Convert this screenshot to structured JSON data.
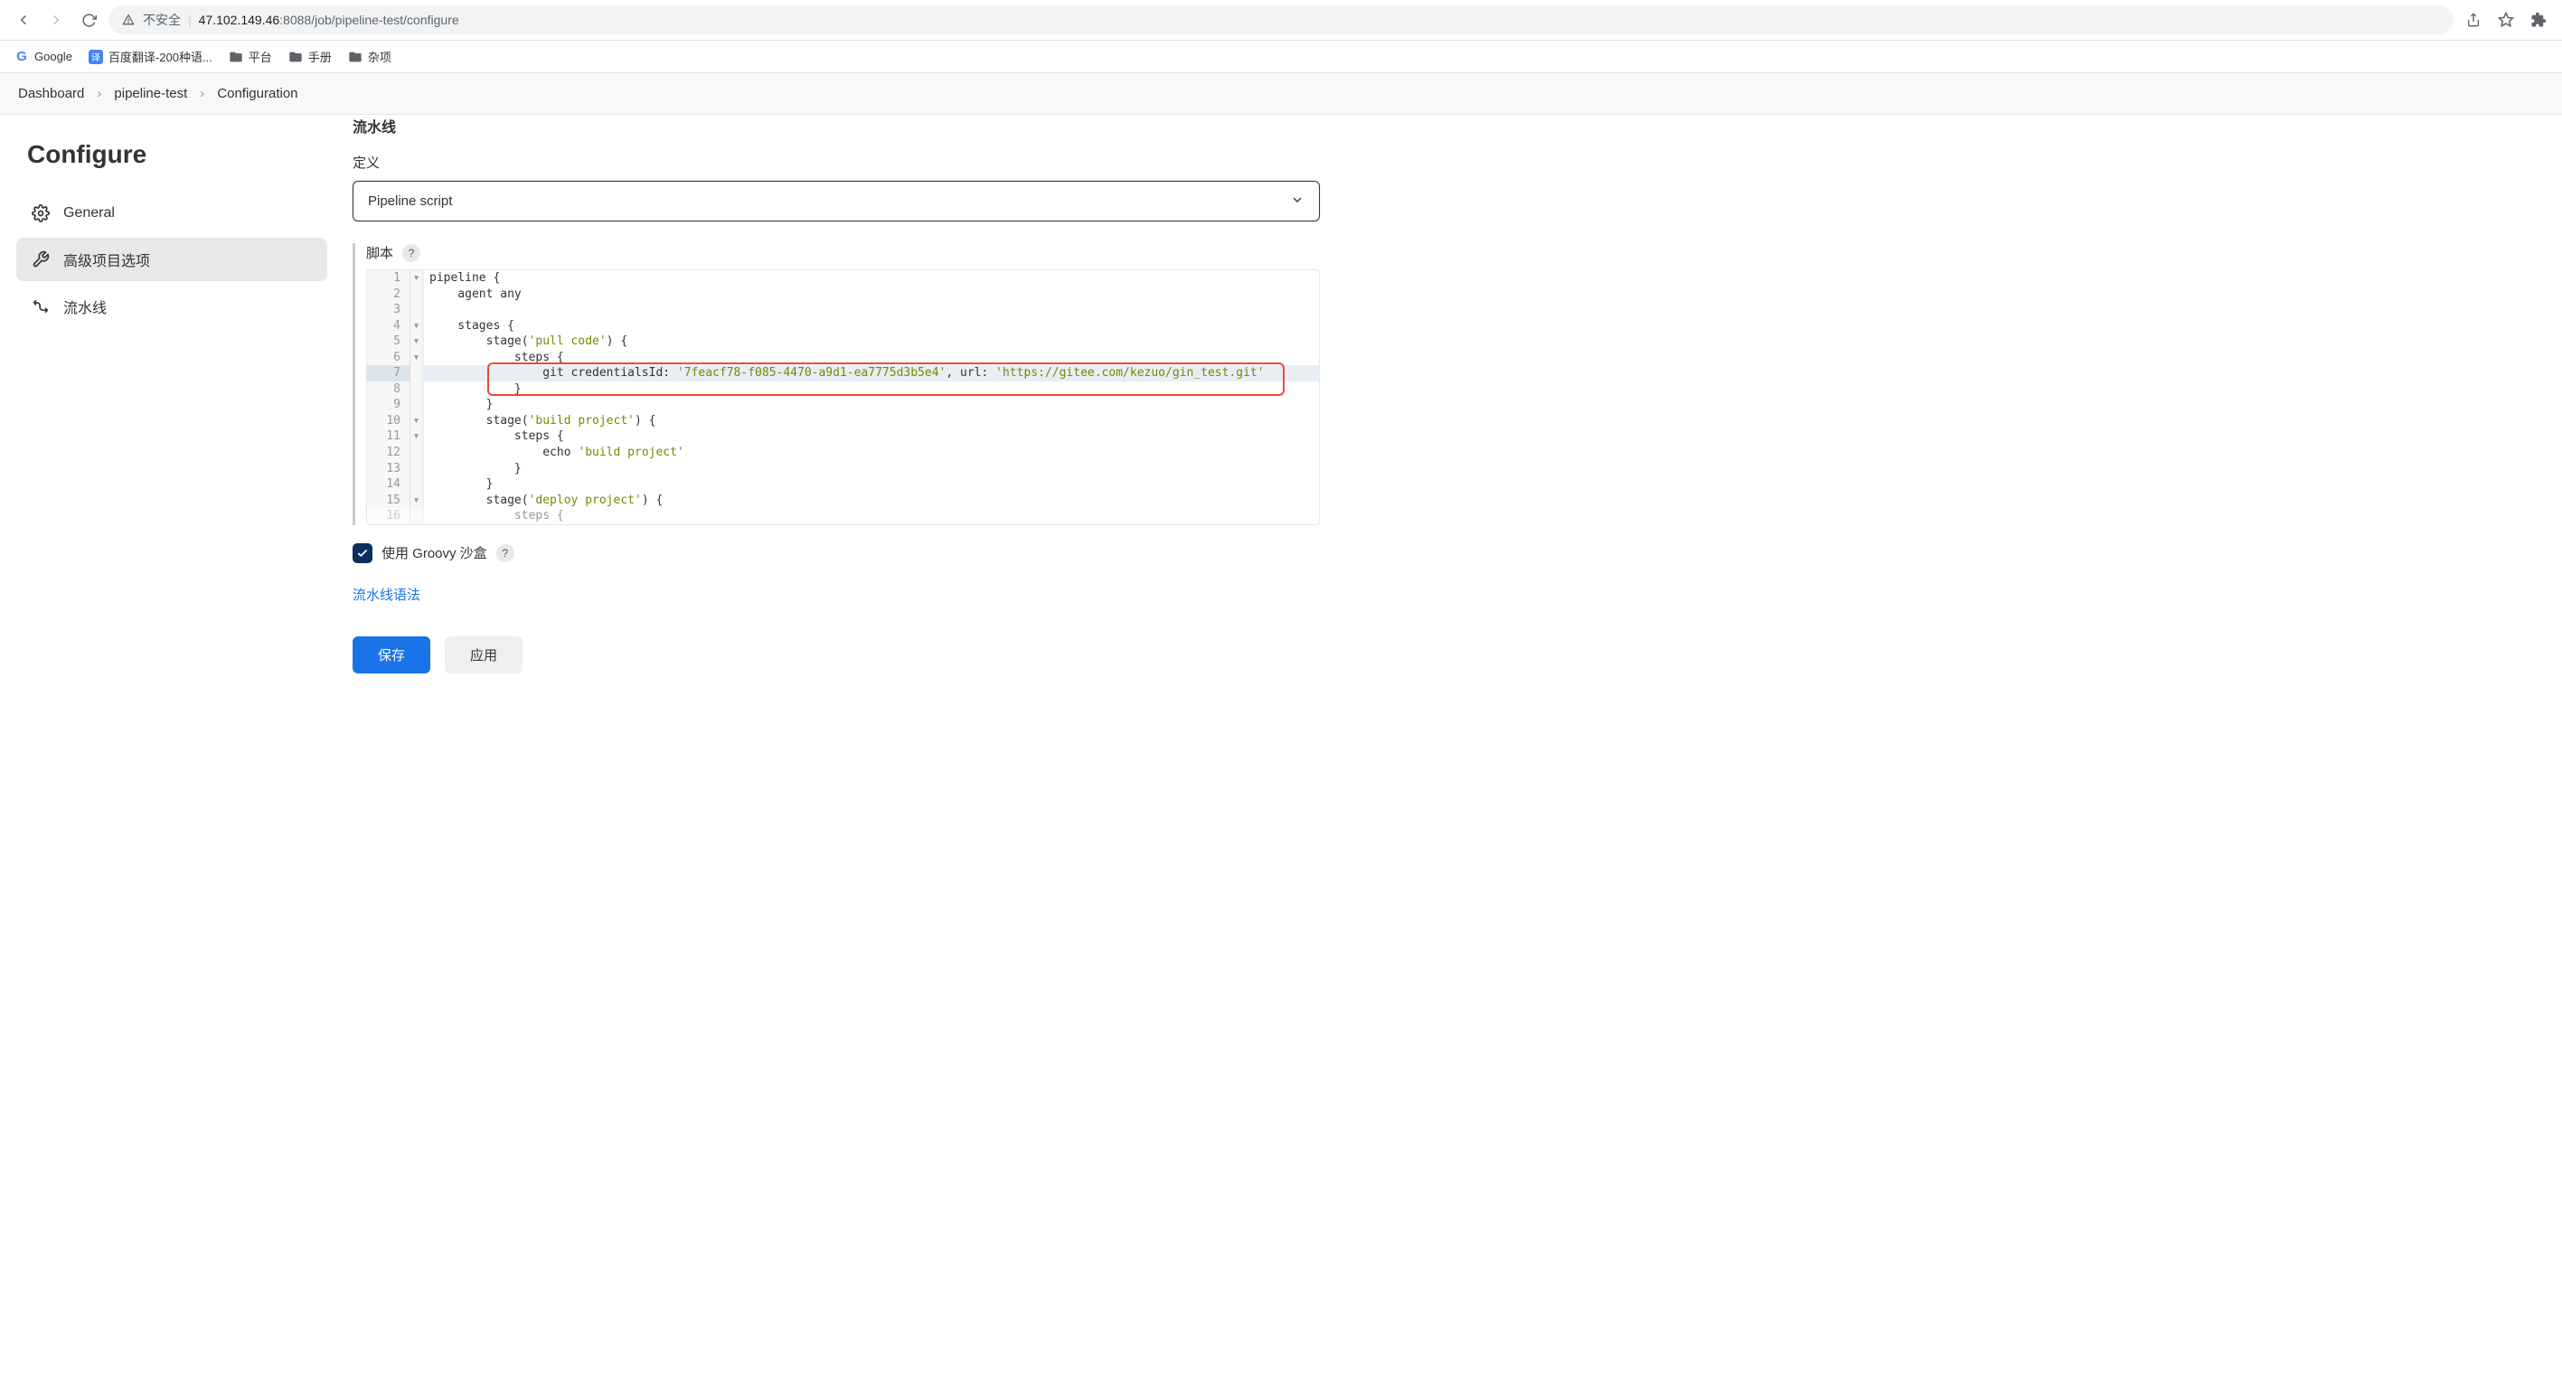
{
  "browser": {
    "insecure_label": "不安全",
    "url_host": "47.102.149.46",
    "url_port": ":8088",
    "url_path": "/job/pipeline-test/configure"
  },
  "bookmarks": {
    "google": "Google",
    "baidu": "百度翻译-200种语...",
    "platform": "平台",
    "manual": "手册",
    "misc": "杂项"
  },
  "breadcrumb": {
    "dashboard": "Dashboard",
    "project": "pipeline-test",
    "current": "Configuration"
  },
  "page": {
    "title": "Configure"
  },
  "sidebar": {
    "general": "General",
    "advanced": "高级项目选项",
    "pipeline": "流水线"
  },
  "section": {
    "pipeline_title": "流水线",
    "definition_label": "定义",
    "definition_value": "Pipeline script",
    "script_label": "脚本",
    "help": "?"
  },
  "code": {
    "lines": [
      {
        "n": "1",
        "f": "▾",
        "t": "pipeline {"
      },
      {
        "n": "2",
        "f": "",
        "t": "    agent any"
      },
      {
        "n": "3",
        "f": "",
        "t": ""
      },
      {
        "n": "4",
        "f": "▾",
        "t": "    stages {"
      },
      {
        "n": "5",
        "f": "▾",
        "t": "        stage('pull code') {"
      },
      {
        "n": "6",
        "f": "▾",
        "t": "            steps {"
      },
      {
        "n": "7",
        "f": "",
        "t": "                git credentialsId: '7feacf78-f085-4470-a9d1-ea7775d3b5e4', url: 'https://gitee.com/kezuo/gin_test.git'"
      },
      {
        "n": "8",
        "f": "",
        "t": "            }"
      },
      {
        "n": "9",
        "f": "",
        "t": "        }"
      },
      {
        "n": "10",
        "f": "▾",
        "t": "        stage('build project') {"
      },
      {
        "n": "11",
        "f": "▾",
        "t": "            steps {"
      },
      {
        "n": "12",
        "f": "",
        "t": "                echo 'build project'"
      },
      {
        "n": "13",
        "f": "",
        "t": "            }"
      },
      {
        "n": "14",
        "f": "",
        "t": "        }"
      },
      {
        "n": "15",
        "f": "▾",
        "t": "        stage('deploy project') {"
      },
      {
        "n": "16",
        "f": "",
        "t": "            steps {"
      }
    ],
    "highlight_line": 7
  },
  "sandbox": {
    "label": "使用 Groovy 沙盒",
    "checked": true
  },
  "links": {
    "syntax": "流水线语法"
  },
  "buttons": {
    "save": "保存",
    "apply": "应用"
  }
}
